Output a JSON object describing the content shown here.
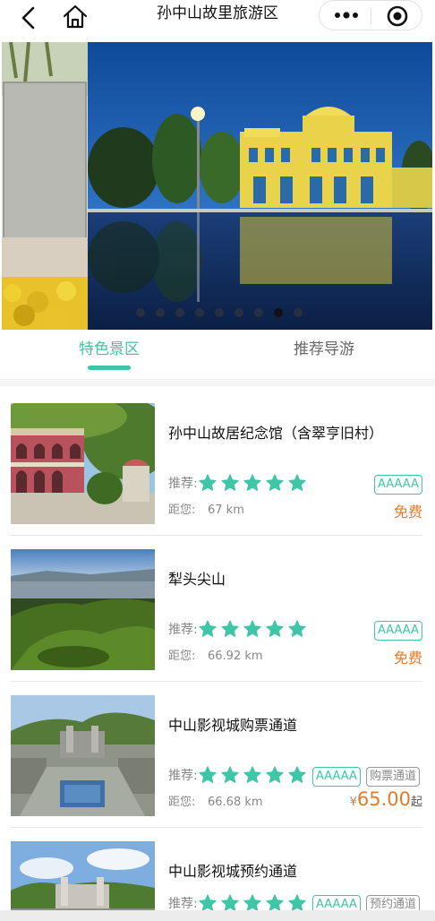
{
  "nav": {
    "title": "孙中山故里旅游区",
    "back_icon": "chevron-left-icon",
    "home_icon": "home-icon",
    "more_icon": "more-dots-icon",
    "close_icon": "target-close-icon"
  },
  "banner": {
    "dots_count": 9,
    "active_index": 7
  },
  "tabs": [
    {
      "label": "特色景区",
      "active": true
    },
    {
      "label": "推荐导游",
      "active": false
    }
  ],
  "colors": {
    "accent": "#3ec6a6",
    "price": "#e67a2a",
    "star": "#3ec6a6"
  },
  "spots": [
    {
      "name": "孙中山故居纪念馆（含翠亨旧村）",
      "rec_label": "推荐:",
      "stars": 5,
      "level": "AAAAA",
      "dist_label": "距您:",
      "distance": "67 km",
      "price_text": "免费"
    },
    {
      "name": "犁头尖山",
      "rec_label": "推荐:",
      "stars": 5,
      "level": "AAAAA",
      "dist_label": "距您:",
      "distance": "66.92 km",
      "price_text": "免费"
    },
    {
      "name": "中山影视城购票通道",
      "rec_label": "推荐:",
      "stars": 5,
      "level": "AAAAA",
      "tag": "购票通道",
      "dist_label": "距您:",
      "distance": "66.68 km",
      "price_currency": "¥",
      "price_amount": "65.00",
      "price_suffix": "起"
    },
    {
      "name": "中山影视城预约通道",
      "rec_label": "推荐:",
      "stars": 5,
      "level": "AAAAA",
      "tag": "预约通道"
    }
  ]
}
